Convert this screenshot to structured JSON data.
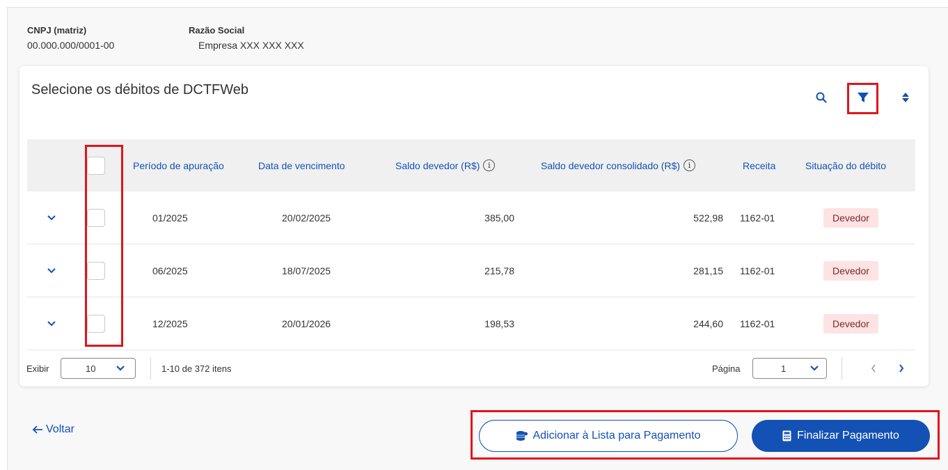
{
  "company": {
    "cnpj_label": "CNPJ (matriz)",
    "cnpj_value": "00.000.000/0001-00",
    "razao_label": "Razão Social",
    "razao_value": "Empresa XXX XXX XXX"
  },
  "card": {
    "title": "Selecione os débitos de DCTFWeb",
    "icons": [
      "search-icon",
      "filter-icon",
      "sort-icon"
    ]
  },
  "table": {
    "headers": {
      "periodo": "Período de apuração",
      "vencimento": "Data de vencimento",
      "saldo": "Saldo devedor (R$)",
      "saldo_consolidado": "Saldo devedor consolidado (R$)",
      "receita": "Receita",
      "situacao": "Situação do débito",
      "info_glyph": "i"
    },
    "rows": [
      {
        "periodo": "01/2025",
        "vencimento": "20/02/2025",
        "saldo": "385,00",
        "saldo_consolidado": "522,98",
        "receita": "1162-01",
        "situacao": "Devedor"
      },
      {
        "periodo": "06/2025",
        "vencimento": "18/07/2025",
        "saldo": "215,78",
        "saldo_consolidado": "281,15",
        "receita": "1162-01",
        "situacao": "Devedor"
      },
      {
        "periodo": "12/2025",
        "vencimento": "20/01/2026",
        "saldo": "198,53",
        "saldo_consolidado": "244,60",
        "receita": "1162-01",
        "situacao": "Devedor"
      }
    ]
  },
  "pagination": {
    "exibir_label": "Exibir",
    "page_size": "10",
    "range_text": "1-10 de 372 itens",
    "pagina_label": "Página",
    "page_number": "1"
  },
  "actions": {
    "back_label": "Voltar",
    "add_label": "Adicionar à Lista para Pagamento",
    "finish_label": "Finalizar Pagamento"
  },
  "colors": {
    "primary": "#1351b4",
    "highlight": "#e0141c",
    "badge_bg": "#fde3e3"
  }
}
